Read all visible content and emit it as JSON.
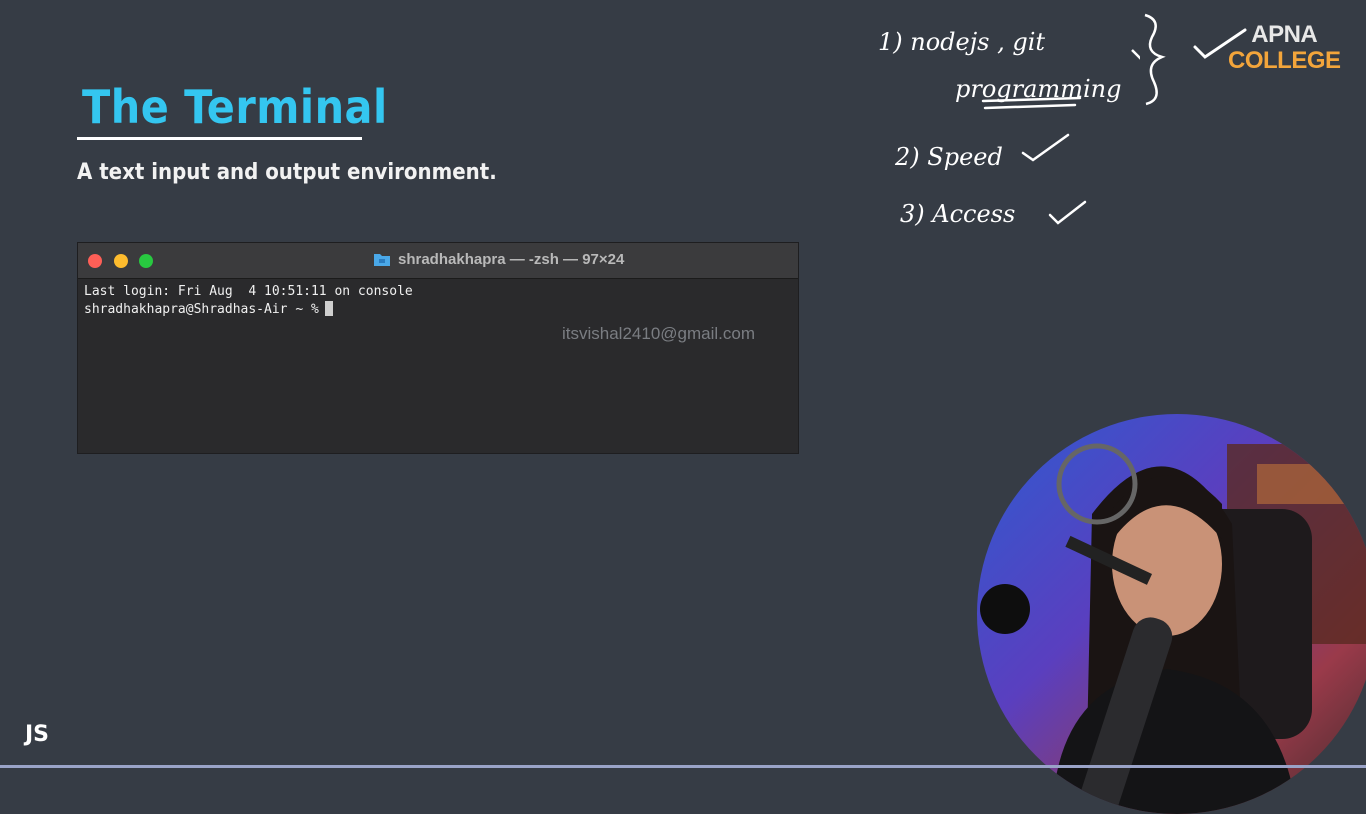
{
  "slide": {
    "title": "The Terminal",
    "subtitle": "A text input and output environment.",
    "corner_label": "JS"
  },
  "terminal": {
    "window_title": "shradhakhapra — -zsh — 97×24",
    "lines": [
      "Last login: Fri Aug  4 10:51:11 on console",
      "shradhakhapra@Shradhas-Air ~ %"
    ]
  },
  "watermark": "itsvishal2410@gmail.com",
  "notes": {
    "line1": "1)  nodejs , git",
    "line1b": "programming",
    "line2": "2)  Speed",
    "line3": "3)  Access"
  },
  "logo": {
    "line1": "APNA",
    "line2": "COLLEGE"
  },
  "colors": {
    "background": "#363c45",
    "title": "#34c6f0",
    "logo_accent": "#f3a53b"
  }
}
